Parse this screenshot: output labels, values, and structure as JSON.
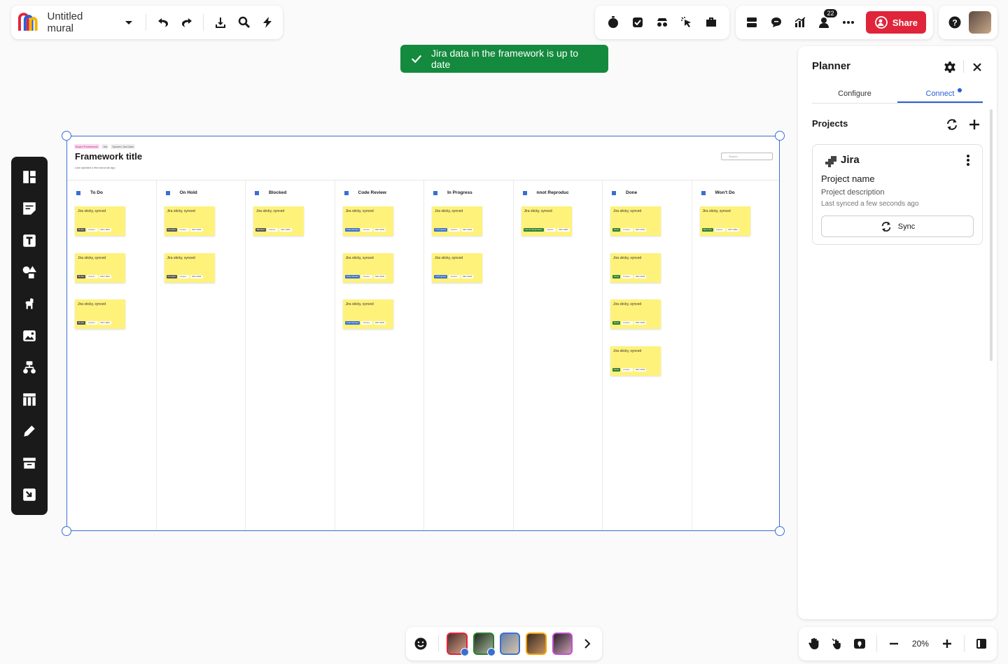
{
  "header": {
    "mural_title": "Untitled mural"
  },
  "share": {
    "label": "Share",
    "collaborators_count": "22"
  },
  "toast": {
    "message": "Jira data in the framework is up to date"
  },
  "framework": {
    "tags": [
      "Board Framework",
      "Jira",
      "Synced Jira Data"
    ],
    "title": "Framework title",
    "updated": "Last updated a few seconds ago",
    "search_placeholder": "Search",
    "columns": [
      {
        "name": "To Do",
        "stickies": 3,
        "status": "To Do",
        "status_color": "#555555"
      },
      {
        "name": "On Hold",
        "stickies": 2,
        "status": "On Hold",
        "status_color": "#555555"
      },
      {
        "name": "Blocked",
        "stickies": 1,
        "status": "Blocked",
        "status_color": "#555555"
      },
      {
        "name": "Code Review",
        "stickies": 3,
        "status": "Code Review",
        "status_color": "#3a6fd1"
      },
      {
        "name": "In Progress",
        "stickies": 2,
        "status": "In Progress",
        "status_color": "#3a6fd1"
      },
      {
        "name": "nnot Reproduc",
        "stickies": 1,
        "status": "Cannot Reproduce",
        "status_color": "#2e7d32"
      },
      {
        "name": "Done",
        "stickies": 4,
        "status": "Done",
        "status_color": "#2e7d32"
      },
      {
        "name": "Won't Do",
        "stickies": 1,
        "status": "Won't Do",
        "status_color": "#2e7d32"
      }
    ],
    "sticky_text": "Jira sticky, synced",
    "sticky_assignee": "Unassi...",
    "sticky_key": "KEY-1001"
  },
  "planner": {
    "title": "Planner",
    "tabs": [
      "Configure",
      "Connect"
    ],
    "active_tab": "Connect",
    "projects_label": "Projects",
    "card": {
      "integration": "Jira",
      "project_name": "Project name",
      "project_description": "Project description",
      "last_synced": "Last synced a few seconds ago",
      "sync_label": "Sync"
    }
  },
  "zoom": {
    "level": "20%"
  },
  "colors": {
    "accent": "#3a6fd1",
    "share": "#e0253a",
    "toast": "#138a3d",
    "sticky": "#fef27a"
  }
}
